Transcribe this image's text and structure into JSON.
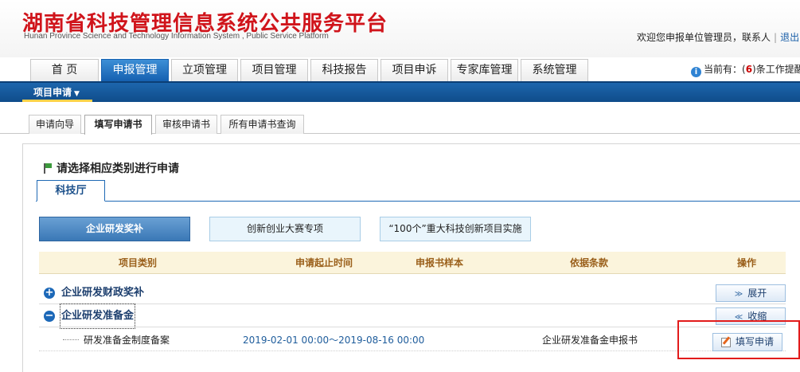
{
  "header": {
    "title_cn": "湖南省科技管理信息系统公共服务平台",
    "title_en": "Hunan Province Science and Technology Information System , Public Service Platform",
    "welcome": "欢迎您申报单位管理员，联系人",
    "separator": "|",
    "logout": "退出"
  },
  "main_nav": {
    "tabs": [
      {
        "label": "首 页",
        "active": false
      },
      {
        "label": "申报管理",
        "active": true
      },
      {
        "label": "立项管理",
        "active": false
      },
      {
        "label": "项目管理",
        "active": false
      },
      {
        "label": "科技报告",
        "active": false
      },
      {
        "label": "项目申诉",
        "active": false
      },
      {
        "label": "专家库管理",
        "active": false
      },
      {
        "label": "系统管理",
        "active": false
      }
    ],
    "notice_prefix": "当前有：(",
    "notice_count": "6",
    "notice_suffix": ")条工作提醒"
  },
  "sub_bar": {
    "dropdown_label": "项目申请",
    "caret": "▼"
  },
  "sub_tabs": [
    {
      "label": "申请向导",
      "active": false
    },
    {
      "label": "填写申请书",
      "active": true
    },
    {
      "label": "审核申请书",
      "active": false
    },
    {
      "label": "所有申请书查询",
      "active": false
    }
  ],
  "panel": {
    "title": "请选择相应类别进行申请",
    "dept_tab": "科技厅",
    "categories": [
      {
        "label": "企业研发奖补",
        "active": true
      },
      {
        "label": "创新创业大赛专项",
        "active": false
      },
      {
        "label": "“100个”重大科技创新项目实施",
        "active": false
      }
    ],
    "columns": [
      "项目类别",
      "申请起止时间",
      "申报书样本",
      "依据条款",
      "操作"
    ],
    "groups": [
      {
        "name": "企业研发财政奖补",
        "expanded": false,
        "button": "展开",
        "icon": "plus-icon",
        "chev": "≫"
      },
      {
        "name": "企业研发准备金",
        "expanded": true,
        "button": "收缩",
        "icon": "minus-icon",
        "chev": "≪"
      }
    ],
    "rows": [
      {
        "name": "研发准备金制度备案",
        "period": "2019-02-01 00:00～2019-08-16 00:00",
        "sample": "企业研发准备金申报书",
        "action": "填写申请"
      }
    ]
  },
  "colors": {
    "brand_red": "#d0141b",
    "nav_blue": "#1560b0",
    "highlight_red": "#e21b1b"
  }
}
